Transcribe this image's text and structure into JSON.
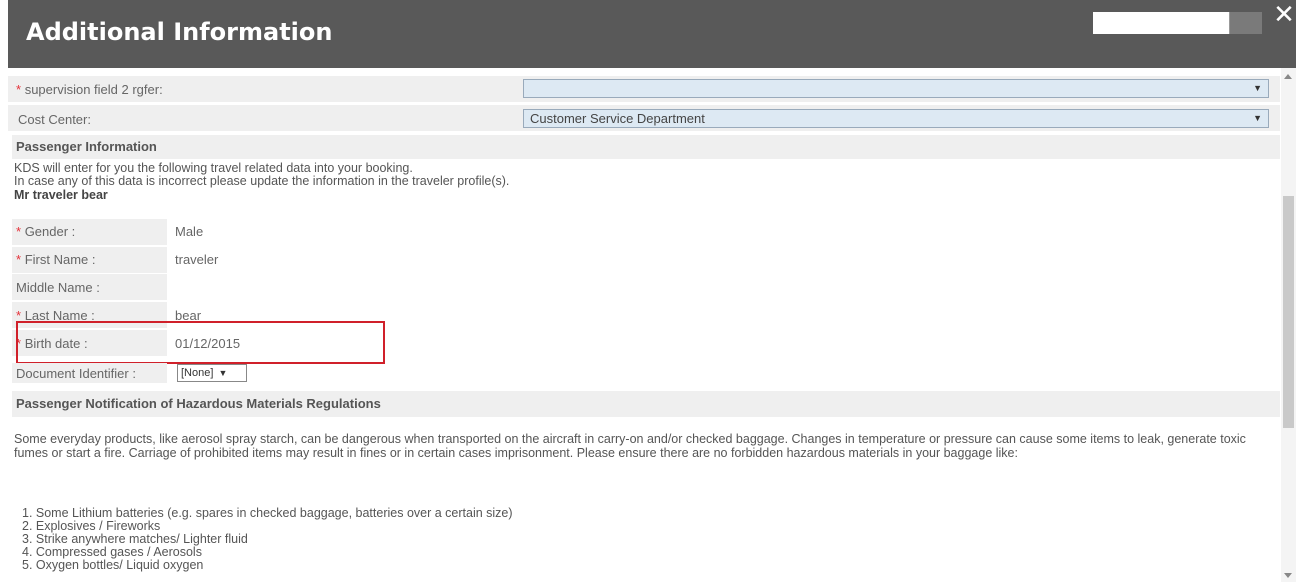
{
  "dialog": {
    "title": "Additional Information",
    "close_symbol": "✕"
  },
  "form": {
    "supervision_field": {
      "required_mark": "*",
      "label": "supervision field 2 rgfer:",
      "value": ""
    },
    "cost_center": {
      "label": "Cost Center:",
      "value": "Customer Service Department"
    }
  },
  "passenger": {
    "section_title": "Passenger Information",
    "intro_line1": "KDS will enter for you the following travel related data into your booking.",
    "intro_line2": "In case any of this data is incorrect please update the information in the traveler profile(s).",
    "traveler_name": "Mr traveler bear",
    "fields": [
      {
        "required_mark": "*",
        "label": "Gender :",
        "value": "Male"
      },
      {
        "required_mark": "*",
        "label": "First Name :",
        "value": "traveler"
      },
      {
        "required_mark": "",
        "label": "Middle Name :",
        "value": ""
      },
      {
        "required_mark": "*",
        "label": "Last Name :",
        "value": "bear"
      },
      {
        "required_mark": "*",
        "label": "Birth date :",
        "value": "01/12/2015"
      }
    ],
    "document_identifier": {
      "label": "Document Identifier :",
      "value": "[None]"
    }
  },
  "hazmat": {
    "section_title": "Passenger Notification of Hazardous Materials Regulations",
    "paragraph": "Some everyday products, like aerosol spray starch, can be dangerous when transported on the aircraft in carry-on and/or checked baggage. Changes in temperature or pressure can cause some items to leak, generate toxic fumes or start a fire. Carriage of prohibited items may result in fines or in certain cases imprisonment. Please ensure there are no forbidden hazardous materials in your baggage like:",
    "items": [
      "1. Some Lithium batteries (e.g. spares in checked baggage, batteries over a certain size)",
      "2. Explosives / Fireworks",
      "3. Strike anywhere matches/ Lighter fluid",
      "4. Compressed gases / Aerosols",
      "5. Oxygen bottles/ Liquid oxygen"
    ]
  },
  "colors": {
    "header_bg": "#595959",
    "required": "#e5323a",
    "highlight_border": "#d0202a",
    "select_bg": "#dde9f3"
  }
}
